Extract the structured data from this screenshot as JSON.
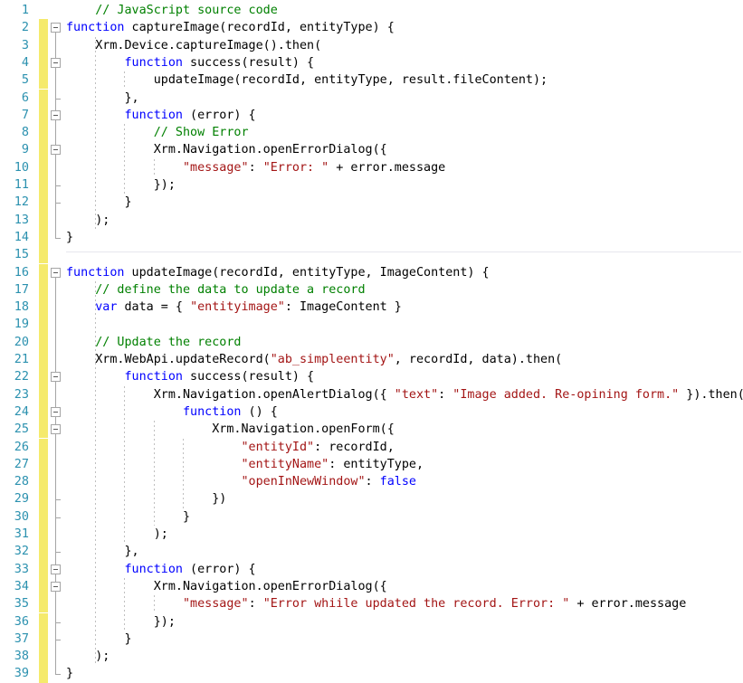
{
  "editor": {
    "language": "JavaScript",
    "first_line": 1,
    "last_line": 39,
    "line_height_px": 19.3,
    "colors": {
      "background": "#FFFFFF",
      "line_number": "#2B91AF",
      "change_bar_unsaved": "#F5EA6C",
      "comment": "#008000",
      "keyword": "#0000FF",
      "string": "#A31515",
      "plain_text": "#000000",
      "outline_glyph": "#A5A5A5",
      "indent_guide": "#BFBFBF",
      "region_separator": "#E6E6ED"
    }
  },
  "line_numbers": [
    "1",
    "2",
    "3",
    "4",
    "5",
    "6",
    "7",
    "8",
    "9",
    "10",
    "11",
    "12",
    "13",
    "14",
    "15",
    "16",
    "17",
    "18",
    "19",
    "20",
    "21",
    "22",
    "23",
    "24",
    "25",
    "26",
    "27",
    "28",
    "29",
    "30",
    "31",
    "32",
    "33",
    "34",
    "35",
    "36",
    "37",
    "38",
    "39"
  ],
  "lines": [
    {
      "number": 1,
      "changed": false,
      "text": "    // JavaScript source code",
      "tokens": [
        {
          "t": "    ",
          "k": "plain"
        },
        {
          "t": "// JavaScript source code",
          "k": "comment"
        }
      ]
    },
    {
      "number": 2,
      "changed": true,
      "fold": "start",
      "text": "function captureImage(recordId, entityType) {",
      "tokens": [
        {
          "t": "function",
          "k": "keyword"
        },
        {
          "t": " captureImage(recordId, entityType) {",
          "k": "plain"
        }
      ]
    },
    {
      "number": 3,
      "changed": true,
      "text": "    Xrm.Device.captureImage().then(",
      "tokens": [
        {
          "t": "    Xrm.Device.captureImage().then(",
          "k": "plain"
        }
      ]
    },
    {
      "number": 4,
      "changed": true,
      "fold": "start",
      "text": "        function success(result) {",
      "tokens": [
        {
          "t": "        ",
          "k": "plain"
        },
        {
          "t": "function",
          "k": "keyword"
        },
        {
          "t": " success(result) {",
          "k": "plain"
        }
      ]
    },
    {
      "number": 5,
      "changed": true,
      "text": "            updateImage(recordId, entityType, result.fileContent);",
      "tokens": [
        {
          "t": "            updateImage(recordId, entityType, result.fileContent);",
          "k": "plain"
        }
      ]
    },
    {
      "number": 6,
      "changed": true,
      "fold": "end",
      "text": "        },",
      "tokens": [
        {
          "t": "        },",
          "k": "plain"
        }
      ]
    },
    {
      "number": 7,
      "changed": true,
      "fold": "start",
      "text": "        function (error) {",
      "tokens": [
        {
          "t": "        ",
          "k": "plain"
        },
        {
          "t": "function",
          "k": "keyword"
        },
        {
          "t": " (error) {",
          "k": "plain"
        }
      ]
    },
    {
      "number": 8,
      "changed": true,
      "text": "            // Show Error",
      "tokens": [
        {
          "t": "            ",
          "k": "plain"
        },
        {
          "t": "// Show Error",
          "k": "comment"
        }
      ]
    },
    {
      "number": 9,
      "changed": true,
      "fold": "start",
      "text": "            Xrm.Navigation.openErrorDialog({",
      "tokens": [
        {
          "t": "            Xrm.Navigation.openErrorDialog({",
          "k": "plain"
        }
      ]
    },
    {
      "number": 10,
      "changed": true,
      "text": "                \"message\": \"Error: \" + error.message",
      "tokens": [
        {
          "t": "                ",
          "k": "plain"
        },
        {
          "t": "\"message\"",
          "k": "string"
        },
        {
          "t": ": ",
          "k": "plain"
        },
        {
          "t": "\"Error: \"",
          "k": "string"
        },
        {
          "t": " + error.message",
          "k": "plain"
        }
      ]
    },
    {
      "number": 11,
      "changed": true,
      "fold": "end",
      "text": "            });",
      "tokens": [
        {
          "t": "            });",
          "k": "plain"
        }
      ]
    },
    {
      "number": 12,
      "changed": true,
      "fold": "end",
      "text": "        }",
      "tokens": [
        {
          "t": "        }",
          "k": "plain"
        }
      ]
    },
    {
      "number": 13,
      "changed": true,
      "text": "    );",
      "tokens": [
        {
          "t": "    );",
          "k": "plain"
        }
      ]
    },
    {
      "number": 14,
      "changed": true,
      "fold": "end",
      "text": "}",
      "tokens": [
        {
          "t": "}",
          "k": "plain"
        }
      ]
    },
    {
      "number": 15,
      "changed": true,
      "separator": true,
      "text": "",
      "tokens": []
    },
    {
      "number": 16,
      "changed": true,
      "fold": "start",
      "text": "function updateImage(recordId, entityType, ImageContent) {",
      "tokens": [
        {
          "t": "function",
          "k": "keyword"
        },
        {
          "t": " updateImage(recordId, entityType, ImageContent) {",
          "k": "plain"
        }
      ]
    },
    {
      "number": 17,
      "changed": true,
      "text": "    // define the data to update a record",
      "tokens": [
        {
          "t": "    ",
          "k": "plain"
        },
        {
          "t": "// define the data to update a record",
          "k": "comment"
        }
      ]
    },
    {
      "number": 18,
      "changed": true,
      "text": "    var data = { \"entityimage\": ImageContent }",
      "tokens": [
        {
          "t": "    ",
          "k": "plain"
        },
        {
          "t": "var",
          "k": "keyword"
        },
        {
          "t": " data = { ",
          "k": "plain"
        },
        {
          "t": "\"entityimage\"",
          "k": "string"
        },
        {
          "t": ": ImageContent }",
          "k": "plain"
        }
      ]
    },
    {
      "number": 19,
      "changed": true,
      "text": "",
      "tokens": []
    },
    {
      "number": 20,
      "changed": true,
      "text": "    // Update the record",
      "tokens": [
        {
          "t": "    ",
          "k": "plain"
        },
        {
          "t": "// Update the record",
          "k": "comment"
        }
      ]
    },
    {
      "number": 21,
      "changed": true,
      "text": "    Xrm.WebApi.updateRecord(\"ab_simpleentity\", recordId, data).then(",
      "tokens": [
        {
          "t": "    Xrm.WebApi.updateRecord(",
          "k": "plain"
        },
        {
          "t": "\"ab_simpleentity\"",
          "k": "string"
        },
        {
          "t": ", recordId, data).then(",
          "k": "plain"
        }
      ]
    },
    {
      "number": 22,
      "changed": true,
      "fold": "start",
      "text": "        function success(result) {",
      "tokens": [
        {
          "t": "        ",
          "k": "plain"
        },
        {
          "t": "function",
          "k": "keyword"
        },
        {
          "t": " success(result) {",
          "k": "plain"
        }
      ]
    },
    {
      "number": 23,
      "changed": true,
      "text": "            Xrm.Navigation.openAlertDialog({ \"text\": \"Image added. Re-opining form.\" }).then(",
      "tokens": [
        {
          "t": "            Xrm.Navigation.openAlertDialog({ ",
          "k": "plain"
        },
        {
          "t": "\"text\"",
          "k": "string"
        },
        {
          "t": ": ",
          "k": "plain"
        },
        {
          "t": "\"Image added. Re-opining form.\"",
          "k": "string"
        },
        {
          "t": " }).then(",
          "k": "plain"
        }
      ]
    },
    {
      "number": 24,
      "changed": true,
      "fold": "start",
      "text": "                function () {",
      "tokens": [
        {
          "t": "                ",
          "k": "plain"
        },
        {
          "t": "function",
          "k": "keyword"
        },
        {
          "t": " () {",
          "k": "plain"
        }
      ]
    },
    {
      "number": 25,
      "changed": true,
      "fold": "start",
      "text": "                    Xrm.Navigation.openForm({",
      "tokens": [
        {
          "t": "                    Xrm.Navigation.openForm({",
          "k": "plain"
        }
      ]
    },
    {
      "number": 26,
      "changed": true,
      "text": "                        \"entityId\": recordId,",
      "tokens": [
        {
          "t": "                        ",
          "k": "plain"
        },
        {
          "t": "\"entityId\"",
          "k": "string"
        },
        {
          "t": ": recordId,",
          "k": "plain"
        }
      ]
    },
    {
      "number": 27,
      "changed": true,
      "text": "                        \"entityName\": entityType,",
      "tokens": [
        {
          "t": "                        ",
          "k": "plain"
        },
        {
          "t": "\"entityName\"",
          "k": "string"
        },
        {
          "t": ": entityType,",
          "k": "plain"
        }
      ]
    },
    {
      "number": 28,
      "changed": true,
      "text": "                        \"openInNewWindow\": false",
      "tokens": [
        {
          "t": "                        ",
          "k": "plain"
        },
        {
          "t": "\"openInNewWindow\"",
          "k": "string"
        },
        {
          "t": ": ",
          "k": "plain"
        },
        {
          "t": "false",
          "k": "keyword"
        }
      ]
    },
    {
      "number": 29,
      "changed": true,
      "fold": "end",
      "text": "                    })",
      "tokens": [
        {
          "t": "                    })",
          "k": "plain"
        }
      ]
    },
    {
      "number": 30,
      "changed": true,
      "fold": "end",
      "text": "                }",
      "tokens": [
        {
          "t": "                }",
          "k": "plain"
        }
      ]
    },
    {
      "number": 31,
      "changed": true,
      "text": "            );",
      "tokens": [
        {
          "t": "            );",
          "k": "plain"
        }
      ]
    },
    {
      "number": 32,
      "changed": true,
      "fold": "end",
      "text": "        },",
      "tokens": [
        {
          "t": "        },",
          "k": "plain"
        }
      ]
    },
    {
      "number": 33,
      "changed": true,
      "fold": "start",
      "text": "        function (error) {",
      "tokens": [
        {
          "t": "        ",
          "k": "plain"
        },
        {
          "t": "function",
          "k": "keyword"
        },
        {
          "t": " (error) {",
          "k": "plain"
        }
      ]
    },
    {
      "number": 34,
      "changed": true,
      "fold": "start",
      "text": "            Xrm.Navigation.openErrorDialog({",
      "tokens": [
        {
          "t": "            Xrm.Navigation.openErrorDialog({",
          "k": "plain"
        }
      ]
    },
    {
      "number": 35,
      "changed": true,
      "text": "                \"message\": \"Error whiile updated the record. Error: \" + error.message",
      "tokens": [
        {
          "t": "                ",
          "k": "plain"
        },
        {
          "t": "\"message\"",
          "k": "string"
        },
        {
          "t": ": ",
          "k": "plain"
        },
        {
          "t": "\"Error whiile updated the record. Error: \"",
          "k": "string"
        },
        {
          "t": " + error.message",
          "k": "plain"
        }
      ]
    },
    {
      "number": 36,
      "changed": true,
      "fold": "end",
      "text": "            });",
      "tokens": [
        {
          "t": "            });",
          "k": "plain"
        }
      ]
    },
    {
      "number": 37,
      "changed": true,
      "fold": "end",
      "text": "        }",
      "tokens": [
        {
          "t": "        }",
          "k": "plain"
        }
      ]
    },
    {
      "number": 38,
      "changed": true,
      "text": "    );",
      "tokens": [
        {
          "t": "    );",
          "k": "plain"
        }
      ]
    },
    {
      "number": 39,
      "changed": true,
      "fold": "end",
      "text": "}",
      "tokens": [
        {
          "t": "}",
          "k": "plain"
        }
      ]
    }
  ],
  "outline_regions": [
    {
      "start": 2,
      "end": 14,
      "depth": 0
    },
    {
      "start": 4,
      "end": 6,
      "depth": 1
    },
    {
      "start": 7,
      "end": 12,
      "depth": 1
    },
    {
      "start": 9,
      "end": 11,
      "depth": 2
    },
    {
      "start": 16,
      "end": 39,
      "depth": 0
    },
    {
      "start": 22,
      "end": 32,
      "depth": 1
    },
    {
      "start": 24,
      "end": 30,
      "depth": 2
    },
    {
      "start": 25,
      "end": 29,
      "depth": 3
    },
    {
      "start": 33,
      "end": 37,
      "depth": 1
    },
    {
      "start": 34,
      "end": 36,
      "depth": 2
    }
  ],
  "indent_guides": [
    {
      "col": 4,
      "from_line": 3,
      "to_line": 13
    },
    {
      "col": 8,
      "from_line": 5,
      "to_line": 5
    },
    {
      "col": 8,
      "from_line": 8,
      "to_line": 11
    },
    {
      "col": 12,
      "from_line": 10,
      "to_line": 10
    },
    {
      "col": 4,
      "from_line": 17,
      "to_line": 38
    },
    {
      "col": 8,
      "from_line": 23,
      "to_line": 31
    },
    {
      "col": 12,
      "from_line": 25,
      "to_line": 30
    },
    {
      "col": 16,
      "from_line": 26,
      "to_line": 29
    },
    {
      "col": 8,
      "from_line": 34,
      "to_line": 36
    },
    {
      "col": 12,
      "from_line": 35,
      "to_line": 35
    }
  ]
}
